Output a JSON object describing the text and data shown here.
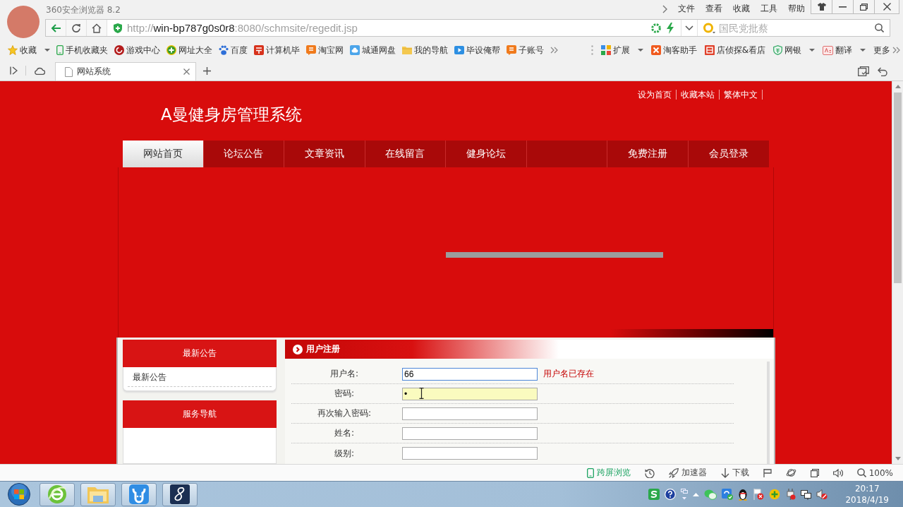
{
  "browser": {
    "title": "360安全浏览器 8.2",
    "menu": [
      "文件",
      "查看",
      "收藏",
      "工具",
      "帮助"
    ],
    "address": {
      "scheme": "http://",
      "host": "win-bp787g0s0r8",
      "path": ":8080/schmsite/regedit.jsp"
    },
    "search": {
      "placeholder": "国民党批蔡"
    },
    "bookmarks": [
      {
        "label": "收藏",
        "kind": "menu"
      },
      {
        "label": "手机收藏夹",
        "kind": "link"
      },
      {
        "label": "游戏中心",
        "kind": "link"
      },
      {
        "label": "网址大全",
        "kind": "link"
      },
      {
        "label": "百度",
        "kind": "link"
      },
      {
        "label": "计算机毕",
        "kind": "link"
      },
      {
        "label": "淘宝网",
        "kind": "link"
      },
      {
        "label": "城通网盘",
        "kind": "link"
      },
      {
        "label": "我的导航",
        "kind": "link"
      },
      {
        "label": "毕设俺帮",
        "kind": "link"
      },
      {
        "label": "子账号",
        "kind": "link"
      }
    ],
    "bookmarks_right": [
      {
        "label": "扩展",
        "kind": "menu"
      },
      {
        "label": "淘客助手",
        "kind": "link"
      },
      {
        "label": "店侦探&看店",
        "kind": "link"
      },
      {
        "label": "网银",
        "kind": "menu"
      },
      {
        "label": "翻译",
        "kind": "menu"
      },
      {
        "label": "更多",
        "kind": "more"
      }
    ],
    "tabs": [
      {
        "title": "网站系统",
        "selected": true
      }
    ]
  },
  "site": {
    "top_links": [
      "设为首页",
      "收藏本站",
      "繁体中文"
    ],
    "title": "A曼健身房管理系统",
    "nav": [
      {
        "label": "网站首页",
        "selected": true
      },
      {
        "label": "论坛公告",
        "selected": false
      },
      {
        "label": "文章资讯",
        "selected": false
      },
      {
        "label": "在线留言",
        "selected": false
      },
      {
        "label": "健身论坛",
        "selected": false
      }
    ],
    "nav_right": [
      {
        "label": "免费注册",
        "selected": false
      },
      {
        "label": "会员登录",
        "selected": false
      }
    ],
    "sidebar": [
      {
        "title": "最新公告",
        "items": [
          "最新公告"
        ]
      },
      {
        "title": "服务导航"
      }
    ],
    "form": {
      "title": "用户注册",
      "fields": [
        {
          "label": "用户名:",
          "value": "66",
          "focused": true,
          "highlighted": false,
          "error": "用户名已存在"
        },
        {
          "label": "密码:",
          "value": "•",
          "focused": false,
          "highlighted": true
        },
        {
          "label": "再次输入密码:",
          "focused": false,
          "highlighted": false
        },
        {
          "label": "姓名:",
          "focused": false,
          "highlighted": false
        },
        {
          "label": "级别:",
          "focused": false,
          "highlighted": false
        }
      ]
    }
  },
  "status_bar": {
    "items": [
      "跨屏浏览",
      "加速器",
      "下载"
    ],
    "zoom": "100%"
  },
  "taskbar": {
    "time": "20:17",
    "date": "2018/4/19"
  }
}
